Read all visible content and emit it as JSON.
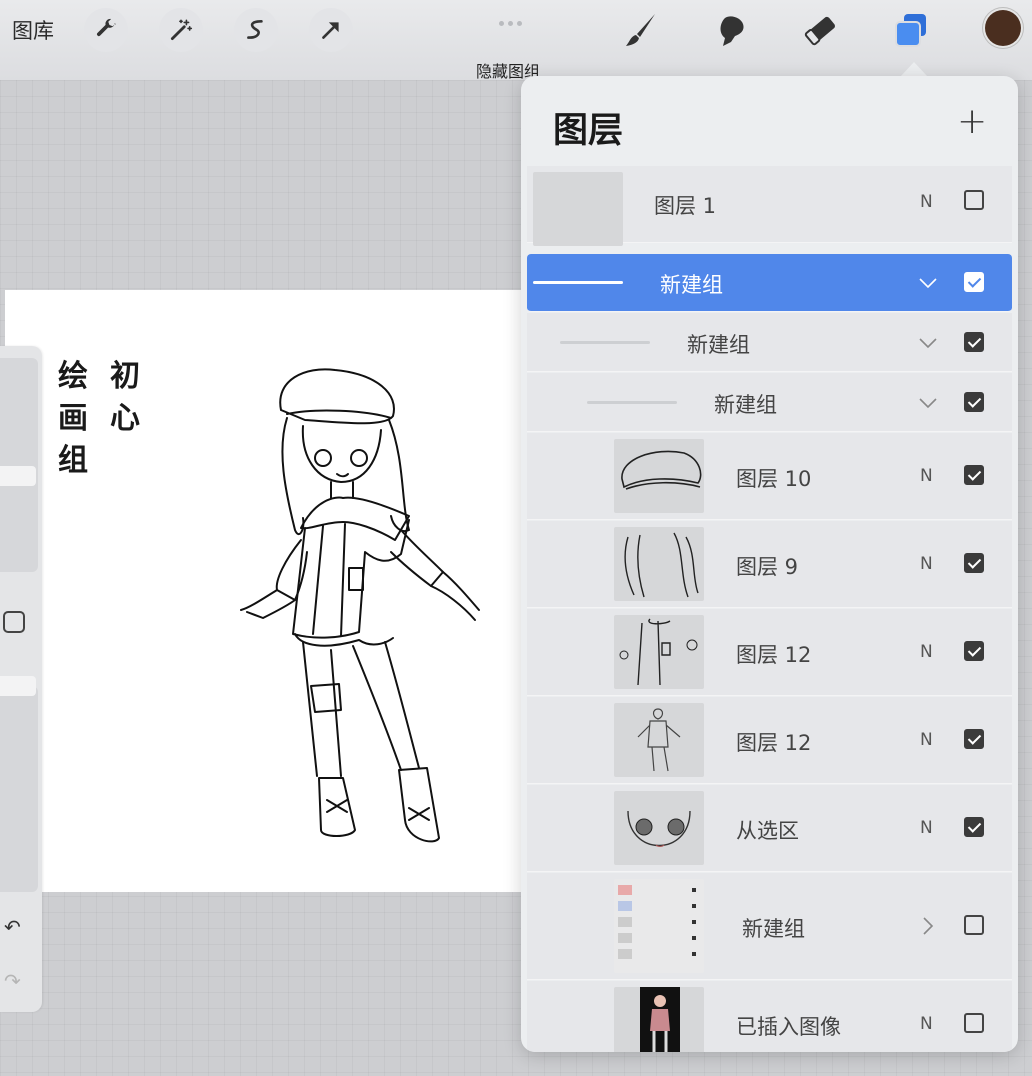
{
  "topbar": {
    "gallery_label": "图库",
    "hide_groups_label": "隐藏图组"
  },
  "colors": {
    "accent": "#5087ea",
    "current_color": "#4a2e1f"
  },
  "canvas_logo": {
    "col1": [
      "绘",
      "画",
      "组"
    ],
    "col2": [
      "初",
      "心"
    ]
  },
  "layers_panel": {
    "title": "图层",
    "add_icon": "plus-icon",
    "rows": [
      {
        "name": "图层 1",
        "blend": "N",
        "visible": false,
        "type": "layer"
      },
      {
        "name": "新建组",
        "visible": true,
        "type": "group",
        "expanded": true,
        "selected": true
      },
      {
        "name": "新建组",
        "visible": true,
        "type": "group",
        "expanded": true
      },
      {
        "name": "新建组",
        "visible": true,
        "type": "group",
        "expanded": true
      },
      {
        "name": "图层 10",
        "blend": "N",
        "visible": true,
        "type": "layer"
      },
      {
        "name": "图层 9",
        "blend": "N",
        "visible": true,
        "type": "layer"
      },
      {
        "name": "图层 12",
        "blend": "N",
        "visible": true,
        "type": "layer"
      },
      {
        "name": "图层 12",
        "blend": "N",
        "visible": true,
        "type": "layer"
      },
      {
        "name": "从选区",
        "blend": "N",
        "visible": true,
        "type": "layer"
      },
      {
        "name": "新建组",
        "visible": false,
        "type": "group",
        "expanded": false
      },
      {
        "name": "已插入图像",
        "blend": "N",
        "visible": false,
        "type": "layer"
      }
    ]
  }
}
